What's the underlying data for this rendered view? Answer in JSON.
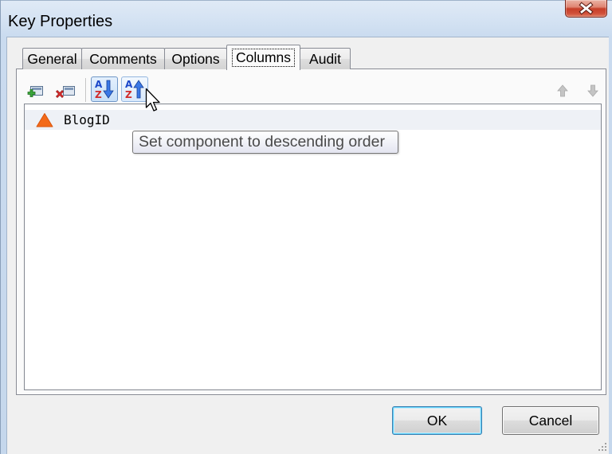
{
  "window": {
    "title": "Key Properties",
    "close_icon": "close-icon"
  },
  "tabs": [
    {
      "label": "General",
      "active": false
    },
    {
      "label": "Comments",
      "active": false
    },
    {
      "label": "Options",
      "active": false
    },
    {
      "label": "Columns",
      "active": true
    },
    {
      "label": "Audit",
      "active": false
    }
  ],
  "toolbar": {
    "add_column": {
      "icon": "add-column-icon",
      "enabled": true
    },
    "remove_column": {
      "icon": "remove-column-icon",
      "enabled": true
    },
    "sort_ascending": {
      "icon": "sort-ascending-icon",
      "letters": [
        "A",
        "Z"
      ],
      "checked": true
    },
    "sort_descending": {
      "icon": "sort-descending-icon",
      "letters": [
        "A",
        "Z"
      ],
      "hovered": true
    },
    "move_up": {
      "icon": "move-up-arrow-icon",
      "enabled": false
    },
    "move_down": {
      "icon": "move-down-arrow-icon",
      "enabled": false
    }
  },
  "columns": [
    {
      "name": "BlogID",
      "order_icon": "ascending-order-triangle-icon",
      "highlighted": true
    }
  ],
  "tooltip": {
    "text": "Set component to descending order"
  },
  "buttons": {
    "ok_label": "OK",
    "cancel_label": "Cancel",
    "ok_is_default": true
  },
  "cursor": {
    "icon": "arrow-pointer-icon"
  },
  "colors": {
    "title_bar": "#d5e3f3",
    "close_button": "#c63f29",
    "dialog_background": "#f0f0f0",
    "tab_border": "#898c95",
    "list_background": "#ffffff",
    "row_highlight": "#eef1f6",
    "order_icon": "#f36a1a",
    "sort_letter_a": "#1b47c9",
    "sort_letter_z": "#d02b2b",
    "default_button_border": "#3c7fb1"
  }
}
